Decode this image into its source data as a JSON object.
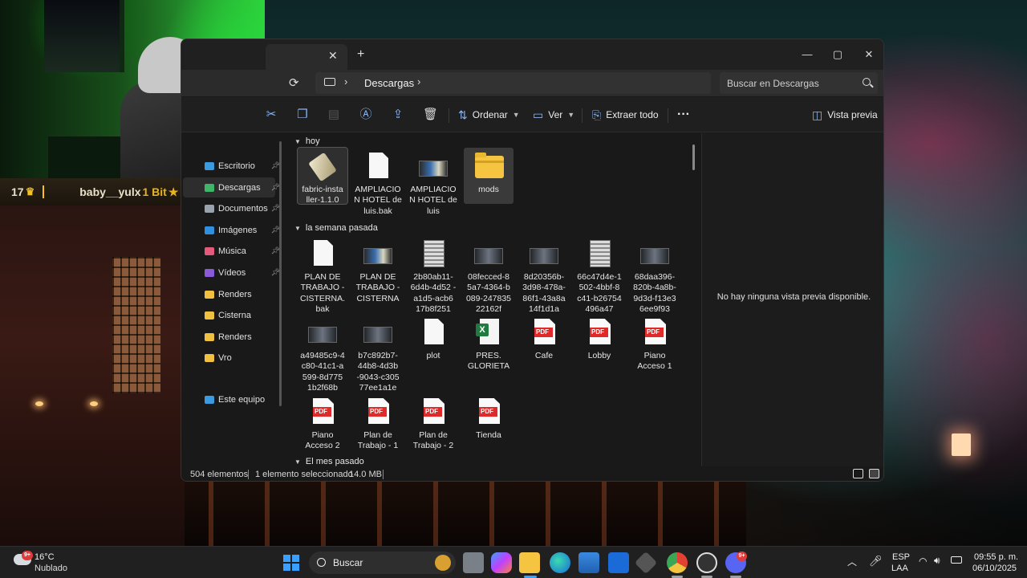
{
  "stream_overlay": {
    "count": "17",
    "username": "baby__yulx",
    "bits": "1 Bit"
  },
  "explorer": {
    "title_controls": {
      "close_tab": "✕",
      "new_tab": "+",
      "minimize": "—",
      "maximize": "▢",
      "close": "✕"
    },
    "breadcrumb": {
      "location": "Descargas"
    },
    "search": {
      "placeholder": "Buscar en Descargas"
    },
    "commandbar": {
      "sort_label": "Ordenar",
      "view_label": "Ver",
      "extract_label": "Extraer todo",
      "more_label": "···",
      "preview_label": "Vista previa"
    },
    "nav": [
      {
        "label": "Escritorio",
        "pinned": true,
        "color": "#3b9be0"
      },
      {
        "label": "Descargas",
        "pinned": true,
        "color": "#3fb56a"
      },
      {
        "label": "Documentos",
        "pinned": true,
        "color": "#9aa3ad"
      },
      {
        "label": "Imágenes",
        "pinned": true,
        "color": "#2f8fe0"
      },
      {
        "label": "Música",
        "pinned": true,
        "color": "#e35a7a"
      },
      {
        "label": "Vídeos",
        "pinned": true,
        "color": "#8a5ad8"
      },
      {
        "label": "Renders",
        "pinned": false,
        "color": "#f0c040"
      },
      {
        "label": "Cisterna",
        "pinned": false,
        "color": "#f0c040"
      },
      {
        "label": "Renders",
        "pinned": false,
        "color": "#f0c040"
      },
      {
        "label": "Vro",
        "pinned": false,
        "color": "#f0c040"
      },
      {
        "label": "Este equipo",
        "pinned": false,
        "color": "#3b9be0"
      }
    ],
    "groups": [
      {
        "header": "hoy",
        "items": [
          {
            "name": "fabric-insta ller-1.1.0",
            "icon": "installer-icon",
            "state": "hovered"
          },
          {
            "name": "AMPLIACIO N HOTEL de luis.bak",
            "icon": "document-icon"
          },
          {
            "name": "AMPLIACIO N HOTEL de luis",
            "icon": "image-thumbnail-icon"
          },
          {
            "name": "mods",
            "icon": "folder-icon",
            "state": "selected"
          }
        ]
      },
      {
        "header": "la semana pasada",
        "items": [
          {
            "name": "PLAN DE TRABAJO - CISTERNA. bak",
            "icon": "document-icon"
          },
          {
            "name": "PLAN DE TRABAJO - CISTERNA",
            "icon": "image-thumbnail-icon"
          },
          {
            "name": "2b80ab11- 6d4b-4d52 -a1d5-acb6 17b8f251",
            "icon": "document-thumbnail-icon"
          },
          {
            "name": "08fecced-8 5a7-4364-b 089-247835 22162f",
            "icon": "photo-thumbnail-icon"
          },
          {
            "name": "8d20356b- 3d98-478a- 86f1-43a8a 14f1d1a",
            "icon": "photo-thumbnail-icon"
          },
          {
            "name": "66c47d4e-1 502-4bbf-8 c41-b26754 496a47",
            "icon": "document-thumbnail-icon"
          },
          {
            "name": "68daa396- 820b-4a8b- 9d3d-f13e3 6ee9f93",
            "icon": "photo-thumbnail-icon"
          },
          {
            "name": "a49485c9-4 c80-41c1-a 599-8d775 1b2f68b",
            "icon": "photo-thumbnail-icon"
          },
          {
            "name": "b7c892b7- 44b8-4d3b -9043-c305 77ee1a1e",
            "icon": "photo-thumbnail-icon"
          },
          {
            "name": "plot",
            "icon": "document-icon"
          },
          {
            "name": "PRES. GLORIETA",
            "icon": "excel-icon"
          },
          {
            "name": "Cafe",
            "icon": "pdf-icon"
          },
          {
            "name": "Lobby",
            "icon": "pdf-icon"
          },
          {
            "name": "Piano Acceso 1",
            "icon": "pdf-icon"
          },
          {
            "name": "Piano Acceso 2",
            "icon": "pdf-icon"
          },
          {
            "name": "Plan de Trabajo - 1",
            "icon": "pdf-icon"
          },
          {
            "name": "Plan de Trabajo - 2",
            "icon": "pdf-icon"
          },
          {
            "name": "Tienda",
            "icon": "pdf-icon"
          }
        ]
      },
      {
        "header": "El mes pasado",
        "items": []
      }
    ],
    "pdf_label": "PDF",
    "excel_label": "X",
    "preview_message": "No hay ninguna vista previa disponible.",
    "status": {
      "count": "504 elementos",
      "selected": "1 elemento seleccionado",
      "size": "14.0 MB"
    }
  },
  "taskbar": {
    "weather": {
      "temp": "16°C",
      "desc": "Nublado",
      "badge": "9+"
    },
    "search_label": "Buscar",
    "discord_badge": "9+",
    "language": {
      "lang": "ESP",
      "layout": "LAA"
    },
    "clock": {
      "time": "09:55 p. m.",
      "date": "06/10/2025"
    }
  },
  "colors": {
    "accent": "#3aa0ff",
    "selection": "#3a3a3a",
    "folder": "#f5c542",
    "pdf": "#e02a2a"
  }
}
